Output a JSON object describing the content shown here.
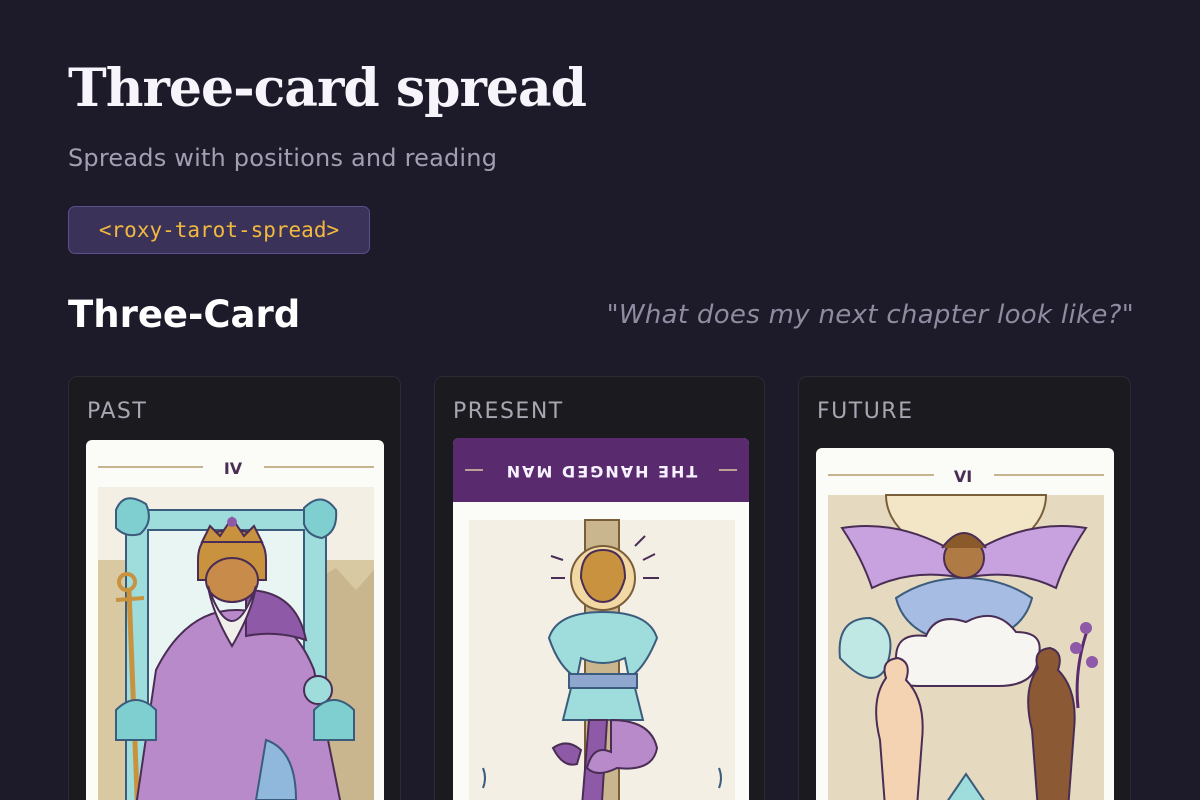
{
  "header": {
    "title": "Three-card spread",
    "subtitle": "Spreads with positions and reading",
    "component_tag": "<roxy-tarot-spread>"
  },
  "spread": {
    "name": "Three-Card",
    "question": "\"What does my next chapter look like?\"",
    "positions": [
      {
        "label": "PAST",
        "card_numeral": "IV",
        "reversed": false
      },
      {
        "label": "PRESENT",
        "card_name": "THE HANGED MAN",
        "reversed": true
      },
      {
        "label": "FUTURE",
        "card_numeral": "VI",
        "reversed": false
      }
    ]
  },
  "colors": {
    "background": "#1d1b29",
    "accent_tag_text": "#f3b93e",
    "card_purple": "#5a2a6e"
  }
}
